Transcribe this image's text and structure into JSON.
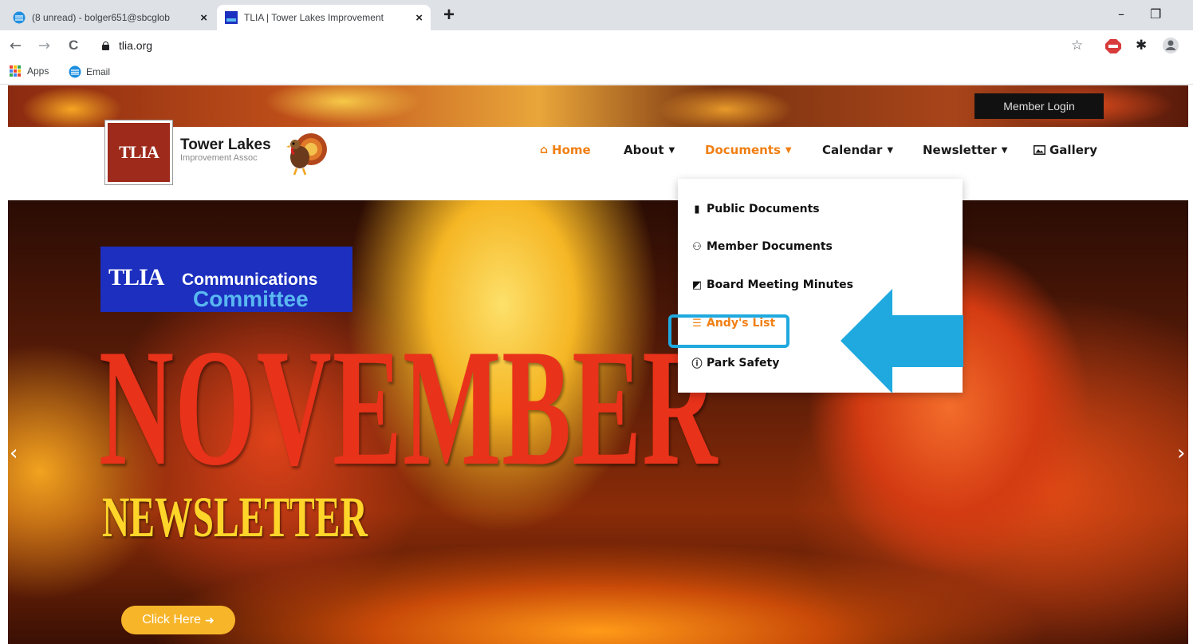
{
  "browser": {
    "tabs": [
      {
        "label": "(8 unread) - bolger651@sbcglob",
        "active": false
      },
      {
        "label": "TLIA | Tower Lakes Improvement",
        "active": true
      }
    ],
    "new_tab": "+",
    "close_glyph": "×",
    "window_controls": {
      "minimize": "–",
      "restore": "❐"
    },
    "nav": {
      "back": "←",
      "forward": "→",
      "reload": "C"
    },
    "url": "tlia.org",
    "bookmarks": [
      {
        "label": "Apps",
        "icon": "apps-grid-icon"
      },
      {
        "label": "Email",
        "icon": "email-favicon-icon"
      }
    ]
  },
  "site": {
    "member_login": "Member Login",
    "logo_abbrev": "TLIA",
    "logo_title": "Tower Lakes",
    "logo_subtitle": "Improvement Assoc",
    "nav_items": [
      {
        "label": "Home",
        "icon": "home-icon",
        "active": true
      },
      {
        "label": "About",
        "has_dropdown": true
      },
      {
        "label": "Documents",
        "has_dropdown": true,
        "open": true
      },
      {
        "label": "Calendar",
        "has_dropdown": true
      },
      {
        "label": "Newsletter",
        "has_dropdown": true
      },
      {
        "label": "Gallery",
        "icon": "image-icon"
      }
    ],
    "documents_menu": [
      {
        "label": "Public Documents",
        "icon": "file-icon"
      },
      {
        "label": "Member Documents",
        "icon": "users-icon"
      },
      {
        "label": "Board Meeting Minutes",
        "icon": "edit-icon"
      },
      {
        "label": "Andy's List",
        "icon": "list-icon",
        "highlighted": true
      },
      {
        "label": "Park Safety",
        "icon": "info-icon"
      }
    ],
    "hero": {
      "committee_abbrev": "TLIA",
      "committee_line1": "Communications",
      "committee_line2": "Committee",
      "headline": "NOVEMBER",
      "subheadline": "NEWSLETTER",
      "cta": "Click Here",
      "prev_arrow": "‹",
      "next_arrow": "›"
    }
  },
  "colors": {
    "accent_orange": "#f07f13",
    "highlight_blue": "#1fa9df",
    "logo_red": "#9e2a1c",
    "committee_blue": "#1c2fbf"
  }
}
